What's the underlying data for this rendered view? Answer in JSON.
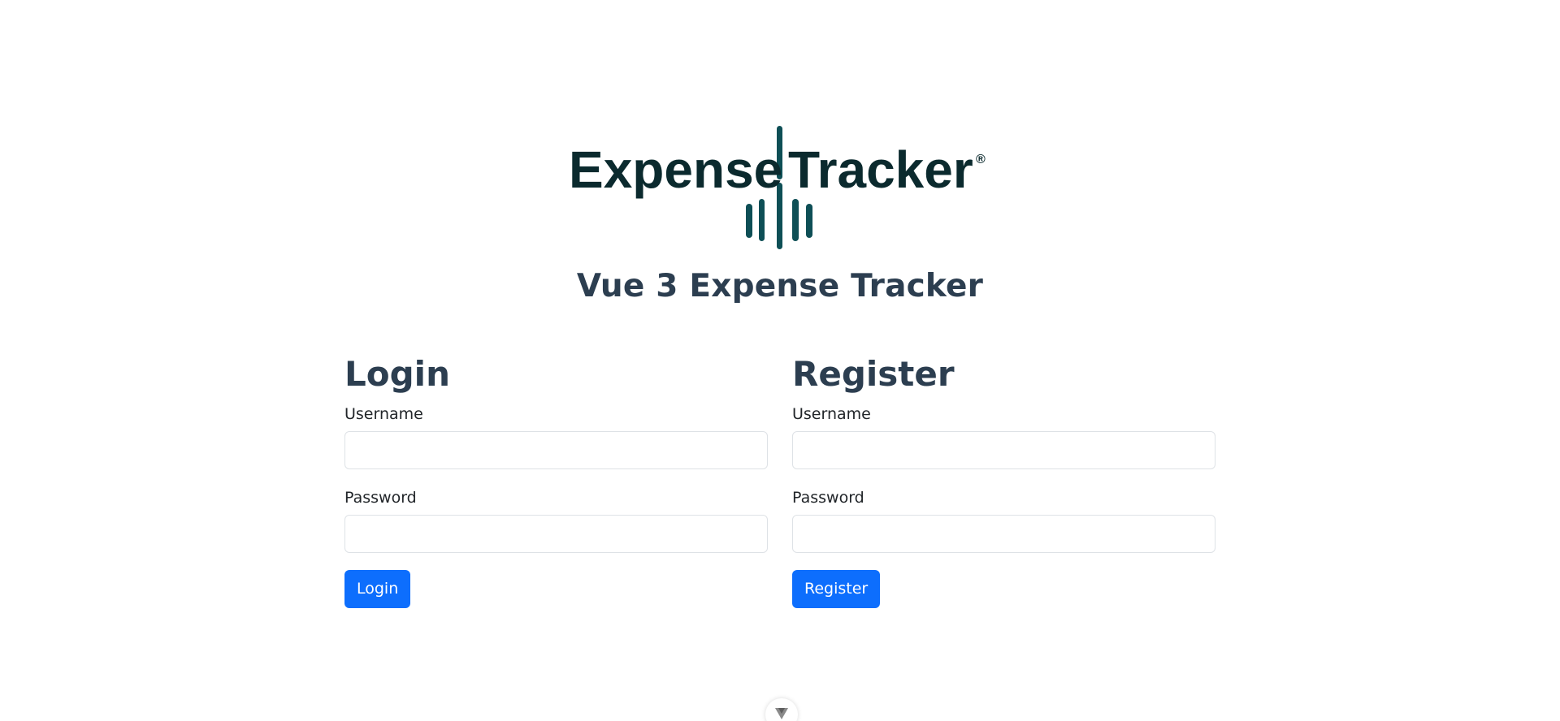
{
  "header": {
    "logo_text_left": "Expense",
    "logo_text_right": "Tracker",
    "logo_registered": "®",
    "app_title": "Vue 3 Expense Tracker"
  },
  "login": {
    "heading": "Login",
    "username_label": "Username",
    "username_value": "",
    "password_label": "Password",
    "password_value": "",
    "submit_label": "Login"
  },
  "register": {
    "heading": "Register",
    "username_label": "Username",
    "username_value": "",
    "password_label": "Password",
    "password_value": "",
    "submit_label": "Register"
  },
  "colors": {
    "logo": "#0b2a2e",
    "logo_accent": "#0e4f56",
    "heading": "#2c3e50",
    "primary_button": "#0d6efd",
    "input_border": "#dee2e6"
  },
  "icons": {
    "devtools_toggle": "vue-chevron-icon"
  }
}
